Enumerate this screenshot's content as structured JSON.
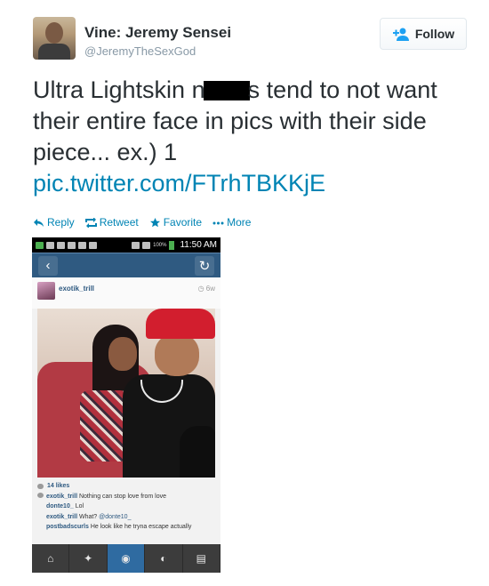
{
  "user": {
    "name": "Vine: Jeremy Sensei",
    "handle": "@JeremyTheSexGod"
  },
  "follow_button": {
    "label": "Follow",
    "icon": "add-user-icon"
  },
  "tweet": {
    "text_before": "Ultra Lightskin n",
    "text_after": "s tend to not want their entire face in pics with their side piece... ex.) 1",
    "link": "pic.twitter.com/FTrhTBKKjE"
  },
  "actions": [
    {
      "label": "Reply",
      "icon": "reply-icon"
    },
    {
      "label": "Retweet",
      "icon": "retweet-icon"
    },
    {
      "label": "Favorite",
      "icon": "star-icon"
    },
    {
      "label": "More",
      "icon": "more-dots-icon"
    }
  ],
  "embedded": {
    "status_bar": {
      "battery": "100%",
      "time": "11:50 AM"
    },
    "post": {
      "username": "exotik_trill",
      "age": "6w",
      "likes": "14 likes",
      "comments": [
        {
          "user": "exotik_trill",
          "text": "Nothing can stop love from love"
        },
        {
          "user": "donte10_",
          "text": "Lol"
        },
        {
          "user": "exotik_trill",
          "text": "What?",
          "mention": "@donte10_"
        },
        {
          "user": "postbadscurls",
          "text": "He look like he tryna escape actually"
        }
      ]
    }
  },
  "colors": {
    "link": "#0084b4",
    "instagram_blue": "#2f5a81",
    "text": "#292f33",
    "muted": "#8899a6"
  }
}
